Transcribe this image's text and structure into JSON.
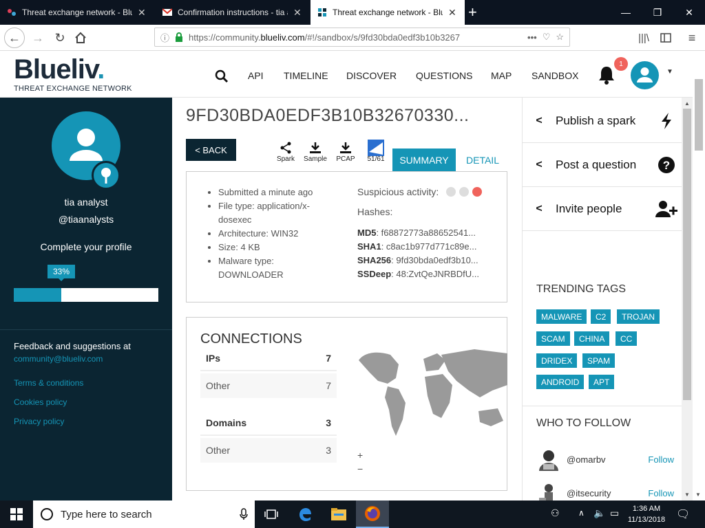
{
  "browser": {
    "tabs": [
      {
        "title": "Threat exchange network - Blueliv",
        "active": false
      },
      {
        "title": "Confirmation instructions - tia analyst",
        "active": false
      },
      {
        "title": "Threat exchange network - Blueliv",
        "active": true
      }
    ],
    "url_prefix": "https://community.",
    "url_host": "blueliv.com",
    "url_path": "/#!/sandbox/s/9fd30bda0edf3b10b3267"
  },
  "site": {
    "brand": "Blueliv",
    "brand_dot": ".",
    "tagline": "THREAT EXCHANGE NETWORK",
    "menu": [
      "API",
      "TIMELINE",
      "DISCOVER",
      "QUESTIONS",
      "MAP",
      "SANDBOX"
    ],
    "notifications": "1"
  },
  "profile": {
    "name": "tia analyst",
    "handle": "@tiaanalysts",
    "complete_label": "Complete your profile",
    "progress_label": "33%",
    "progress": 0.33,
    "feedback_text": "Feedback and suggestions at",
    "feedback_email": "community@blueliv.com",
    "links": [
      "Terms & conditions",
      "Cookies policy",
      "Privacy policy"
    ]
  },
  "sample": {
    "title": "9FD30BDA0EDF3B10B32670330...",
    "back_label": "< BACK",
    "tools": [
      "Spark",
      "Sample",
      "PCAP",
      "51/61"
    ],
    "tab_summary": "SUMMARY",
    "tab_detail": "DETAIL",
    "info": [
      "Submitted a minute ago",
      "File type: application/x-dosexec",
      "Architecture: WIN32",
      "Size: 4 KB",
      "Malware type: DOWNLOADER"
    ],
    "suspicious_label": "Suspicious activity:",
    "hashes_label": "Hashes:",
    "hashes": [
      {
        "k": "MD5",
        "v": ": f68872773a88652541..."
      },
      {
        "k": "SHA1",
        "v": ": c8ac1b977d771c89e..."
      },
      {
        "k": "SHA256",
        "v": ": 9fd30bda0edf3b10..."
      },
      {
        "k": "SSDeep",
        "v": ": 48:ZvtQeJNRBDfU..."
      }
    ],
    "connections_title": "CONNECTIONS",
    "ips_label": "IPs",
    "ips_count": "7",
    "ips_other_label": "Other",
    "ips_other_count": "7",
    "domains_label": "Domains",
    "domains_count": "3",
    "domains_other_label": "Other",
    "domains_other_count": "3",
    "zoom_in": "+",
    "zoom_out": "−"
  },
  "actions": [
    "Publish a spark",
    "Post a question",
    "Invite people"
  ],
  "trending": {
    "title": "TRENDING TAGS",
    "tags": [
      "MALWARE",
      "C2",
      "TROJAN",
      "SCAM",
      "CHINA",
      "CC",
      "DRIDEX",
      "SPAM",
      "ANDROID",
      "APT"
    ]
  },
  "follow": {
    "title": "WHO TO FOLLOW",
    "users": [
      {
        "handle": "@omarbv",
        "action": "Follow"
      },
      {
        "handle": "@itsecurity",
        "action": "Follow"
      }
    ]
  },
  "taskbar": {
    "search_placeholder": "Type here to search",
    "time": "1:36 AM",
    "date": "11/13/2018"
  },
  "colors": {
    "accent": "#1595b6",
    "dark": "#0b2532",
    "alert": "#f0635c"
  }
}
